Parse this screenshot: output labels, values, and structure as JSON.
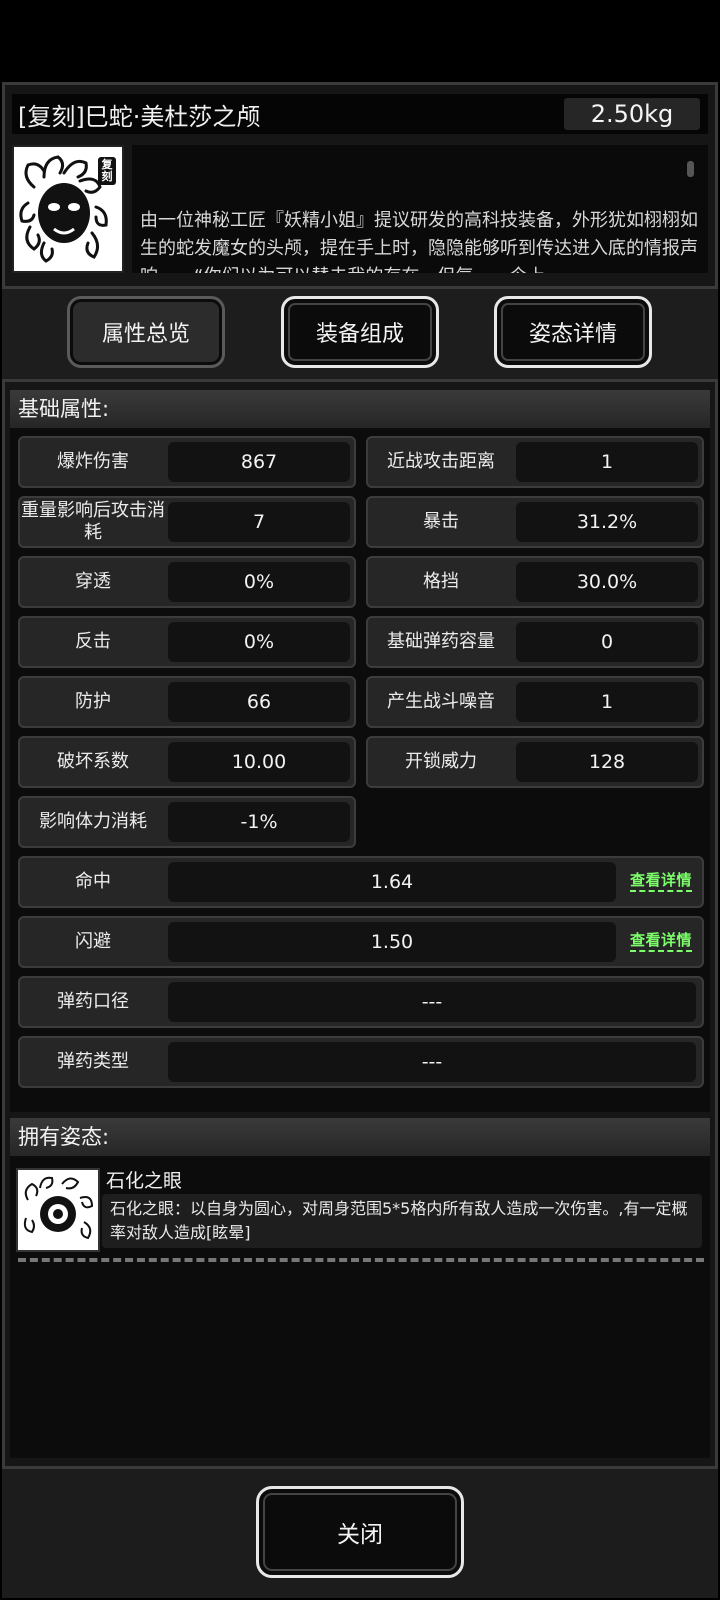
{
  "item": {
    "title": "[复刻]巳蛇·美杜莎之颅",
    "weight": "2.50kg",
    "portrait_badge": "复刻",
    "description": "由一位神秘工匠『妖精小姐』提议研发的高科技装备，外形犹如栩栩如生的蛇发魔女的头颅，提在手上时，隐隐能够听到传达进入底的情报声响……“你们以为可以替去我的存在，但气……今上"
  },
  "tabs": [
    {
      "label": "属性总览",
      "active": true
    },
    {
      "label": "装备组成",
      "active": false
    },
    {
      "label": "姿态详情",
      "active": false
    }
  ],
  "base_stats": {
    "header": "基础属性:",
    "pairs": [
      {
        "label": "爆炸伤害",
        "value": "867"
      },
      {
        "label": "近战攻击距离",
        "value": "1"
      },
      {
        "label": "重量影响后攻击消耗",
        "value": "7"
      },
      {
        "label": "暴击",
        "value": "31.2%"
      },
      {
        "label": "穿透",
        "value": "0%"
      },
      {
        "label": "格挡",
        "value": "30.0%"
      },
      {
        "label": "反击",
        "value": "0%"
      },
      {
        "label": "基础弹药容量",
        "value": "0"
      },
      {
        "label": "防护",
        "value": "66"
      },
      {
        "label": "产生战斗噪音",
        "value": "1"
      },
      {
        "label": "破坏系数",
        "value": "10.00"
      },
      {
        "label": "开锁威力",
        "value": "128"
      },
      {
        "label": "影响体力消耗",
        "value": "-1%"
      }
    ],
    "wide": [
      {
        "label": "命中",
        "value": "1.64",
        "link": "查看详情"
      },
      {
        "label": "闪避",
        "value": "1.50",
        "link": "查看详情"
      },
      {
        "label": "弹药口径",
        "value": "---"
      },
      {
        "label": "弹药类型",
        "value": "---"
      }
    ]
  },
  "stances": {
    "header": "拥有姿态:",
    "items": [
      {
        "name": "石化之眼",
        "description": "石化之眼：以自身为圆心，对周身范围5*5格内所有敌人造成一次伤害。,有一定概率对敌人造成[眩晕]"
      }
    ]
  },
  "footer": {
    "close_label": "关闭"
  },
  "colors": {
    "link_green": "#7cff6a",
    "panel": "#262626",
    "value_bg": "#121212"
  }
}
